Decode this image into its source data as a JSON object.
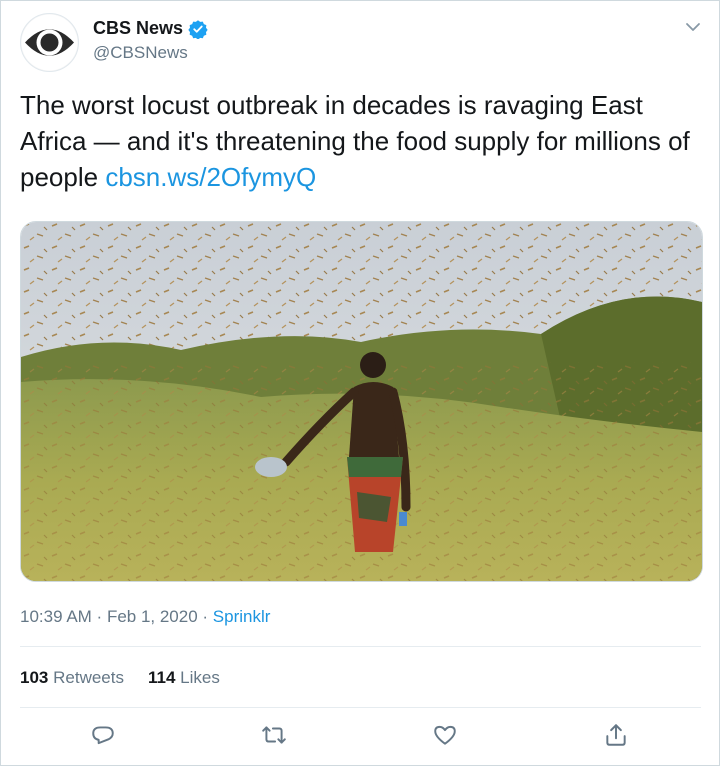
{
  "author": {
    "display_name": "CBS News",
    "handle": "@CBSNews",
    "verified": true
  },
  "tweet": {
    "text": "The worst locust outbreak in decades is ravaging East Africa — and it's threatening the food supply for millions of people ",
    "link_text": "cbsn.ws/2OfymyQ"
  },
  "meta": {
    "time": "10:39 AM",
    "separator1": " · ",
    "date": "Feb 1, 2020",
    "separator2": " · ",
    "source": "Sprinklr"
  },
  "stats": {
    "retweets_count": "103",
    "retweets_label": "Retweets",
    "likes_count": "114",
    "likes_label": "Likes"
  },
  "actions": [
    "reply-icon",
    "retweet-icon",
    "like-icon",
    "share-icon"
  ],
  "colors": {
    "link": "#1b95e0",
    "verified": "#1da1f2",
    "secondary_text": "#657786"
  }
}
